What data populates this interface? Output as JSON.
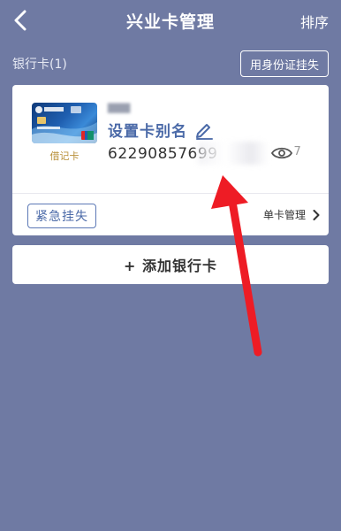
{
  "header": {
    "title": "兴业卡管理",
    "sort_label": "排序"
  },
  "section": {
    "label": "银行卡(1)",
    "report_loss_id_label": "用身份证挂失"
  },
  "card": {
    "type_label": "借记卡",
    "owner_name_masked": "▇▇▇",
    "alias_label": "设置卡别名",
    "number_visible": "62290857699",
    "number_tail": "7",
    "emergency_label": "紧急挂失",
    "manage_label": "单卡管理",
    "thumb_bank_text": "兴业银行"
  },
  "add_card": {
    "label": "+ 添加银行卡"
  },
  "colors": {
    "background": "#6f7aa3",
    "accent": "#4b6aa8",
    "card_type_gold": "#b8903a",
    "arrow": "#ee1c25"
  },
  "icons": {
    "back": "chevron-left-icon",
    "edit": "pencil-icon",
    "eye": "eye-icon",
    "chevron": "chevron-right-icon"
  }
}
